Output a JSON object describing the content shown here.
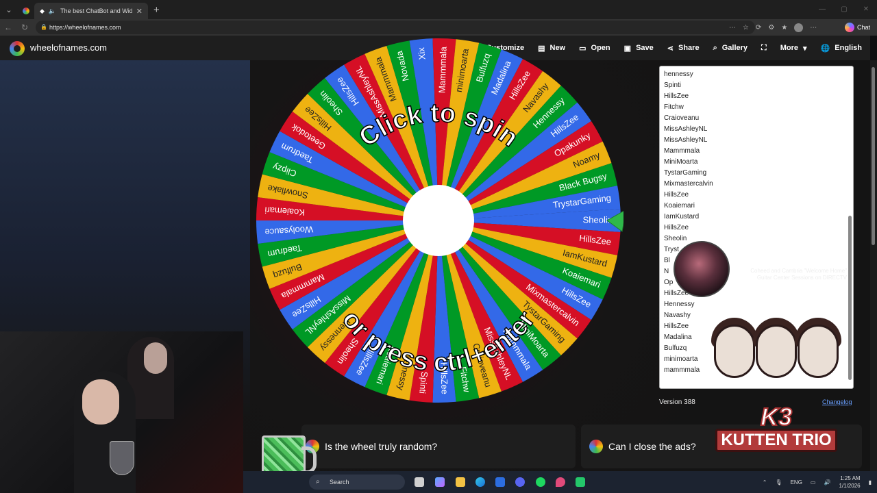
{
  "browser": {
    "tabs": [
      {
        "title": "",
        "active": false
      },
      {
        "title": "The best ChatBot and Widget",
        "active": true
      }
    ],
    "url": "https://wheelofnames.com",
    "chat_label": "Chat"
  },
  "site": {
    "name": "wheelofnames.com",
    "menu": [
      {
        "label": "Customize",
        "icon": "palette-icon"
      },
      {
        "label": "New",
        "icon": "file-icon"
      },
      {
        "label": "Open",
        "icon": "folder-icon"
      },
      {
        "label": "Save",
        "icon": "save-icon"
      },
      {
        "label": "Share",
        "icon": "share-icon"
      },
      {
        "label": "Gallery",
        "icon": "search-icon"
      },
      {
        "label": "",
        "icon": "fullscreen-icon"
      },
      {
        "label": "More",
        "icon": "chevron-down-icon"
      },
      {
        "label": "English",
        "icon": "globe-icon"
      }
    ]
  },
  "wheel": {
    "top_text": "Click to spin",
    "bottom_text": "or press ctrl+enter",
    "colors": [
      "#3369e8",
      "#d50f25",
      "#eeb211",
      "#009925"
    ],
    "segments": [
      "Sheolin",
      "HillsZee",
      "IamKustard",
      "Koaiemari",
      "HillsZee",
      "Mixmastercalvin",
      "TystarGaming",
      "MiniMoarta",
      "Mammmala",
      "MissAshleyNL",
      "Craioveanu",
      "Fitchw",
      "HillsZee",
      "Spinti",
      "hennessy",
      "Koaiemari",
      "HillsZee",
      "Sheolin",
      "Hennessy",
      "MissAshleyNL",
      "HillsZee",
      "Mammmala",
      "Bulfuzq",
      "Taedrum",
      "Woolysauce",
      "Koaiemari",
      "Snowflake",
      "Clipzy",
      "Taedrum",
      "Geetodok",
      "HillsZee",
      "Sheolin",
      "HillsZee",
      "MissAshleyNL",
      "Mammmala",
      "Novada",
      "Xix",
      "Mammmala",
      "minimoarta",
      "Bulfuzq",
      "Madalina",
      "HillsZee",
      "Navashy",
      "Hennessy",
      "HillsZee",
      "Opakunky",
      "Noamy",
      "Black Bugsy",
      "TrystarGaming"
    ]
  },
  "entries": {
    "items": [
      "hennessy",
      "Spinti",
      "HillsZee",
      "Fitchw",
      "Craioveanu",
      "MissAshleyNL",
      "MissAshleyNL",
      "Mammmala",
      "MiniMoarta",
      "TystarGaming",
      "Mixmastercalvin",
      "HillsZee",
      "Koaiemari",
      "IamKustard",
      "HillsZee",
      "Sheolin",
      "Tryst",
      "Bl",
      "N",
      "Op",
      "HillsZee",
      "Hennessy",
      "Navashy",
      "HillsZee",
      "Madalina",
      "Bulfuzq",
      "minimoarta",
      "mammmala"
    ],
    "version": "Version 388",
    "changelog": "Changelog"
  },
  "ad": {
    "title": "Guitar Center",
    "line1": "Coheed and Cambria \"Welcome Home\"",
    "line2": "Guitar Center Sessions on DIRECTV"
  },
  "faq": [
    {
      "question": "Is the wheel truly random?"
    },
    {
      "question": "Can I close the ads?"
    }
  ],
  "overlay": {
    "brand_line1": "K3",
    "brand_line2": "KUTTEN TRIO"
  },
  "taskbar": {
    "search_placeholder": "Search",
    "language": "ENG",
    "time": "1:25 AM",
    "date": "1/1/2026"
  }
}
